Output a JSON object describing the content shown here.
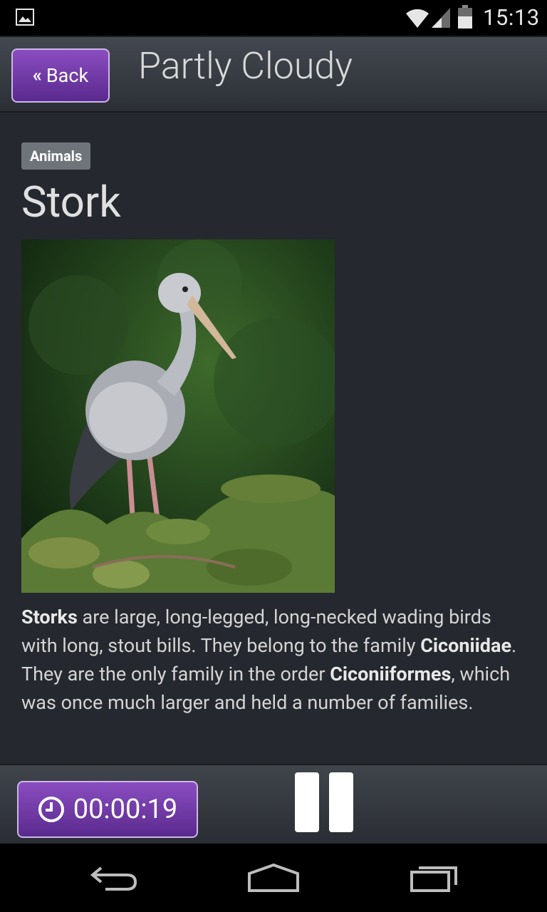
{
  "status_bar": {
    "time": "15:13",
    "icons": [
      "gallery-notification-icon",
      "wifi-icon",
      "signal-icon",
      "battery-icon"
    ]
  },
  "header": {
    "back_label": "Back",
    "title": "Partly Cloudy"
  },
  "article": {
    "category": "Animals",
    "title": "Stork",
    "image_subject": "stork-photo",
    "description": {
      "p1_bold": "Storks",
      "p1_text": " are large, long-legged, long-necked wading birds with long, stout bills. They belong to the family ",
      "p2_bold": "Ciconiidae",
      "p2_text": ". They are the only family in the order ",
      "p3_bold": "Ciconiiformes",
      "p3_text": ", which was once much larger and held a number of families."
    }
  },
  "player": {
    "elapsed": "00:00:19",
    "state_icon": "pause-icon"
  },
  "colors": {
    "accent": "#6a35a3",
    "background": "#25282e",
    "text": "#d4d4d4"
  }
}
